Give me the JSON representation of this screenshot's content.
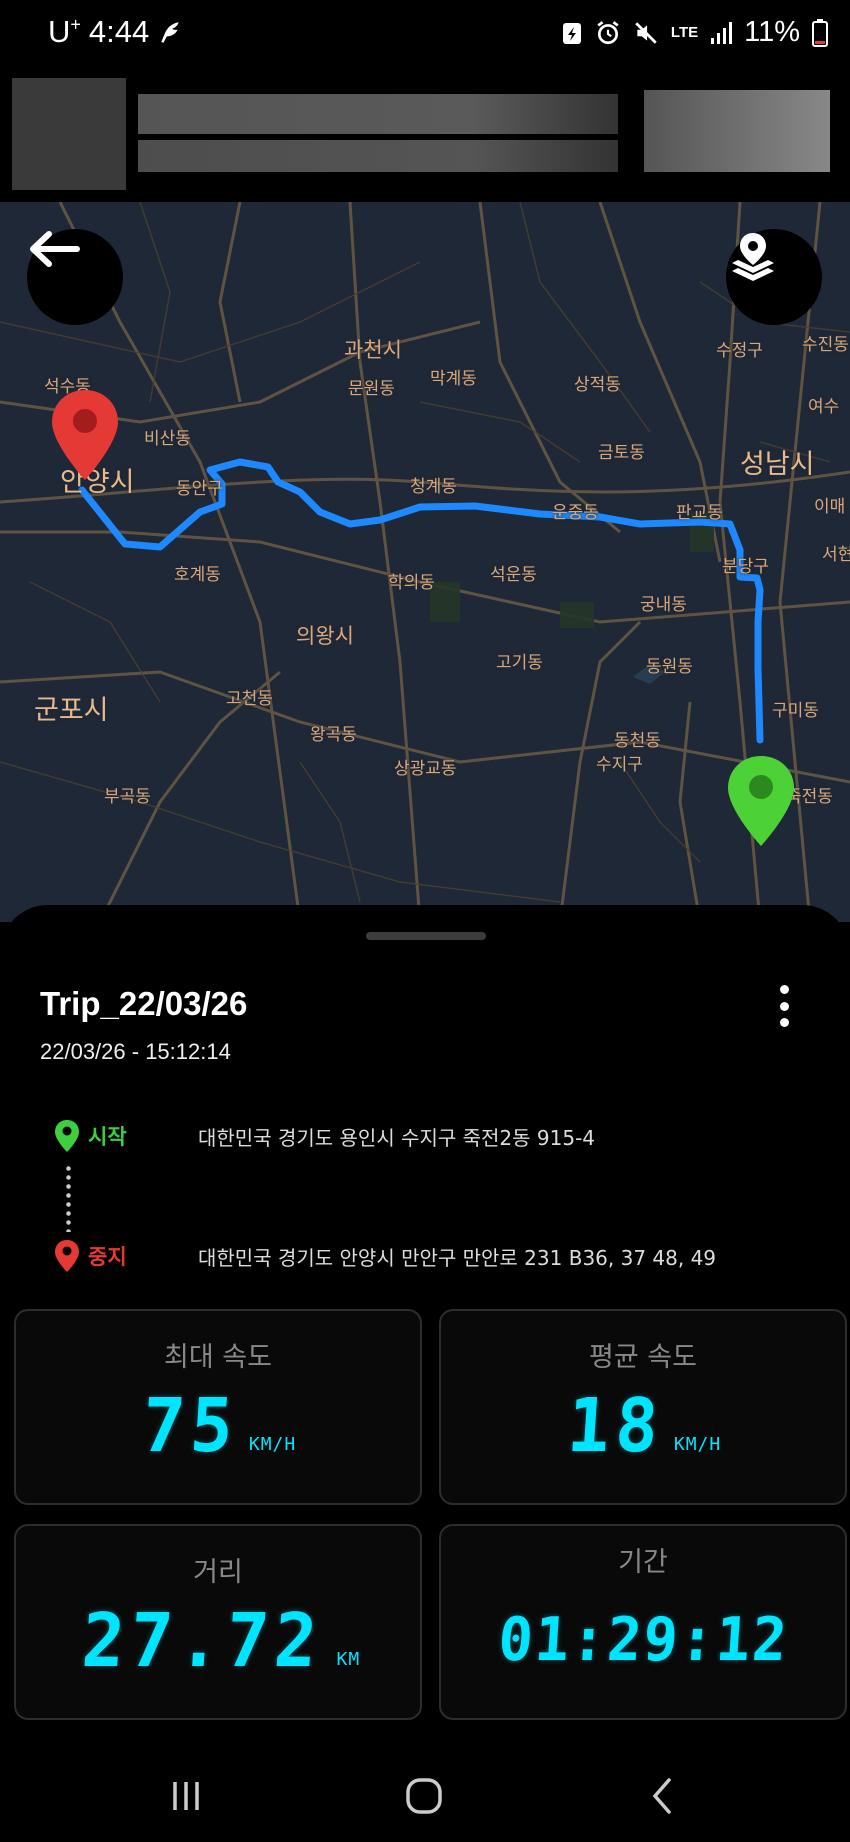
{
  "status_bar": {
    "carrier": "U",
    "carrier_sup": "+",
    "time": "4:44",
    "battery": "11%",
    "network": "LTE"
  },
  "map": {
    "labels": [
      {
        "text": "과천시",
        "size": "mid"
      },
      {
        "text": "수정구",
        "size": "small"
      },
      {
        "text": "수진동",
        "size": "small"
      },
      {
        "text": "석수동",
        "size": "small"
      },
      {
        "text": "막계동",
        "size": "small"
      },
      {
        "text": "상적동",
        "size": "small"
      },
      {
        "text": "여수",
        "size": "small"
      },
      {
        "text": "비산동",
        "size": "small"
      },
      {
        "text": "문원동",
        "size": "small"
      },
      {
        "text": "금토동",
        "size": "small"
      },
      {
        "text": "성남시",
        "size": "big"
      },
      {
        "text": "안양시",
        "size": "big"
      },
      {
        "text": "동안구",
        "size": "small"
      },
      {
        "text": "청계동",
        "size": "small"
      },
      {
        "text": "이매",
        "size": "small"
      },
      {
        "text": "운중동",
        "size": "small"
      },
      {
        "text": "판교동",
        "size": "small"
      },
      {
        "text": "서현",
        "size": "small"
      },
      {
        "text": "호계동",
        "size": "small"
      },
      {
        "text": "학의동",
        "size": "small"
      },
      {
        "text": "석운동",
        "size": "small"
      },
      {
        "text": "분당구",
        "size": "small"
      },
      {
        "text": "궁내동",
        "size": "small"
      },
      {
        "text": "의왕시",
        "size": "mid"
      },
      {
        "text": "고기동",
        "size": "small"
      },
      {
        "text": "동원동",
        "size": "small"
      },
      {
        "text": "군포시",
        "size": "big"
      },
      {
        "text": "고천동",
        "size": "small"
      },
      {
        "text": "구미동",
        "size": "small"
      },
      {
        "text": "왕곡동",
        "size": "small"
      },
      {
        "text": "동천동",
        "size": "small"
      },
      {
        "text": "상광교동",
        "size": "small"
      },
      {
        "text": "수지구",
        "size": "small"
      },
      {
        "text": "부곡동",
        "size": "small"
      },
      {
        "text": "죽전동",
        "size": "small"
      }
    ],
    "colors": {
      "background": "#1f2836",
      "route": "#1e88ff",
      "start_pin": "#3ecf3e",
      "end_pin": "#e53935"
    },
    "icons": {
      "back": "arrow-left-icon",
      "layers": "map-layers-icon"
    }
  },
  "trip": {
    "title": "Trip_22/03/26",
    "datetime": "22/03/26 - 15:12:14",
    "start_label": "시작",
    "start_address": "대한민국 경기도 용인시 수지구 죽전2동 915-4",
    "stop_label": "중지",
    "stop_address": "대한민국 경기도 안양시 만안구 만안로 231 B36, 37 48, 49",
    "start_color": "#3ecf3e",
    "stop_color": "#e53935"
  },
  "stats": {
    "max_speed": {
      "label": "최대 속도",
      "value": "75",
      "unit": "KM/H"
    },
    "avg_speed": {
      "label": "평균 속도",
      "value": "18",
      "unit": "KM/H"
    },
    "distance": {
      "label": "거리",
      "value": "27.72",
      "unit": "KM"
    },
    "duration": {
      "label": "기간",
      "value": "01:29:12"
    },
    "accent_color": "#00e5ff"
  }
}
